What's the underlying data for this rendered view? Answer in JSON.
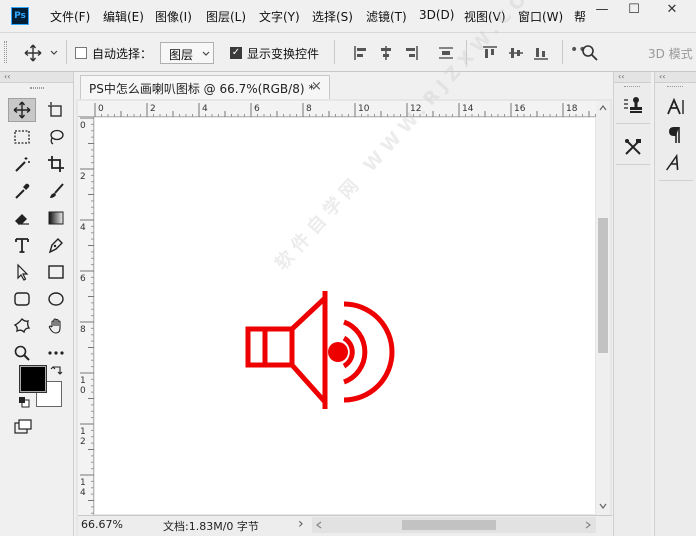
{
  "app": {
    "logo_text": "Ps"
  },
  "menu": [
    "文件(F)",
    "编辑(E)",
    "图像(I)",
    "图层(L)",
    "文字(Y)",
    "选择(S)",
    "滤镜(T)",
    "3D(D)",
    "视图(V)",
    "窗口(W)",
    "帮"
  ],
  "window_controls": {
    "minimize": "—",
    "maximize": "☐",
    "close": "✕"
  },
  "options": {
    "auto_select_label": "自动选择：",
    "auto_select_checked": false,
    "target_value": "图层",
    "show_transform_label": "显示变换控件",
    "show_transform_checked": true,
    "mode_label": "3D 模式"
  },
  "document": {
    "tab_title": "PS中怎么画喇叭图标 @ 66.7%(RGB/8) *",
    "tab_close": "×",
    "ruler_h_labels": [
      "0",
      "2",
      "4",
      "6",
      "8",
      "10",
      "12",
      "14",
      "16",
      "18"
    ],
    "ruler_v_labels": [
      "0",
      "2",
      "4",
      "6",
      "8",
      "1\n0",
      "1\n2",
      "1\n4"
    ],
    "icon_color": "#ee0000"
  },
  "status": {
    "zoom": "66.67%",
    "doc_info": "文档:1.83M/0 字节",
    "arrow": "›"
  },
  "toolbox": {
    "collapse": "‹‹"
  },
  "colors": {
    "foreground": "#000000",
    "background": "#ffffff",
    "accent": "#31a8ff"
  },
  "panels": {
    "collapse_mid": "‹‹",
    "collapse_right": "‹‹"
  },
  "watermark": "软件自学网 WWW.RJZXW.COM"
}
